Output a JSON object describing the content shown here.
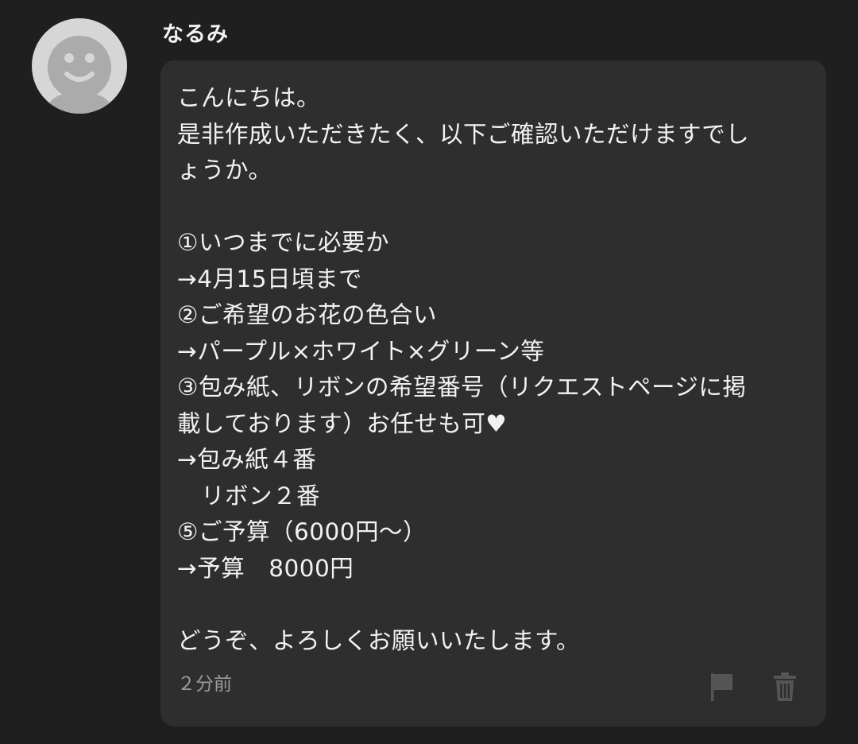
{
  "user": {
    "name": "なるみ",
    "avatar_icon": "smiley-face-icon"
  },
  "message": {
    "text": "こんにちは。\n是非作成いただきたく、以下ご確認いただけますでし\nょうか。\n\n①いつまでに必要か\n→4月15日頃まで\n②ご希望のお花の色合い\n→パープル×ホワイト×グリーン等\n③包み紙、リボンの希望番号（リクエストページに掲\n載しております）お任せも可♥\n→包み紙４番\n　リボン２番\n⑤ご予算（6000円〜）\n→予算　8000円\n\nどうぞ、よろしくお願いいたします。",
    "timestamp": "２分前"
  },
  "actions": {
    "report_icon": "flag-icon",
    "delete_icon": "trash-icon"
  },
  "colors": {
    "background": "#1f1f1f",
    "bubble": "#2e2e2e",
    "text": "#f2f2f2",
    "muted": "#9a9a9a",
    "icon": "#555555",
    "avatar": "#d6d6d6"
  }
}
